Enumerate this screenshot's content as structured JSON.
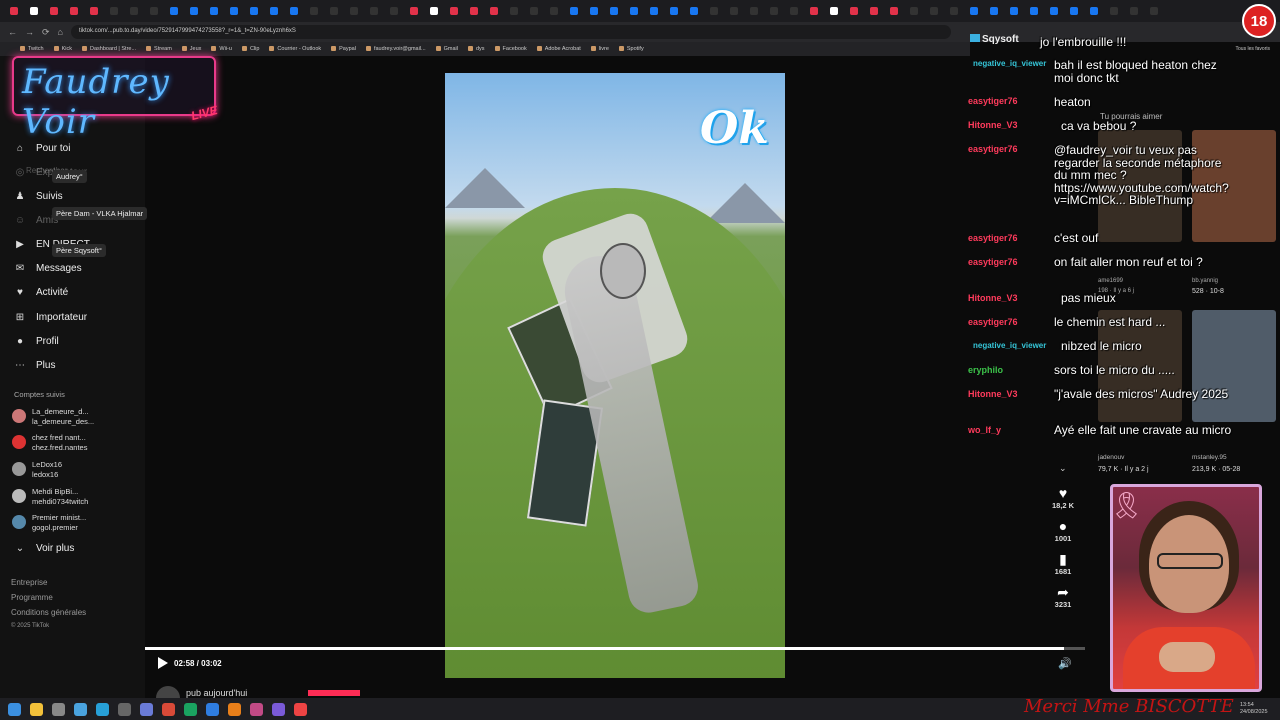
{
  "browser": {
    "url": "tiktok.com/...pub.to.day/video/7529147999474273558?_r=1&_t=ZN-90eLyznh6xS",
    "bookmarks": [
      "Twitch",
      "Kick",
      "Dashboard | Stre...",
      "Stream",
      "Jeux",
      "Wii-u",
      "Clip",
      "Courrier - Outlook",
      "Paypal",
      "faudrey.voir@gmail...",
      "Gmail",
      "dys",
      "Facebook",
      "Adobe Acrobat",
      "livre",
      "Spotify"
    ],
    "favorites_label": "Tous les favoris"
  },
  "overlay": {
    "logo_text": "Faudrey Voir",
    "logo_live": "LIVE",
    "age_badge": "18",
    "footer_text": "Merci Mme BISCOTTE"
  },
  "sidebar": {
    "search_placeholder": "Rechercher",
    "items": [
      {
        "icon": "home-icon",
        "label": "Pour toi"
      },
      {
        "icon": "compass-icon",
        "label": "Explorateur"
      },
      {
        "icon": "following-icon",
        "label": "Suivis"
      },
      {
        "icon": "friends-icon",
        "label": "Amis"
      },
      {
        "icon": "live-icon",
        "label": "EN DIRECT"
      },
      {
        "icon": "messages-icon",
        "label": "Messages"
      },
      {
        "icon": "activity-icon",
        "label": "Activité"
      },
      {
        "icon": "upload-icon",
        "label": "Importateur"
      },
      {
        "icon": "profile-icon",
        "label": "Profil"
      },
      {
        "icon": "more-icon",
        "label": "Plus"
      }
    ],
    "tooltips": [
      "Audrey°",
      "Père Dam - VLKA Hjalmar",
      "Père Sqysoft°"
    ],
    "accounts_title": "Comptes suivis",
    "accounts": [
      {
        "name": "La_demeure_d...",
        "handle": "la_demeure_des..."
      },
      {
        "name": "chez fred nant...",
        "handle": "chez.fred.nantes"
      },
      {
        "name": "LeDox16",
        "handle": "ledox16"
      },
      {
        "name": "Mehdi BipBi...",
        "handle": "mehdi0734twitch"
      },
      {
        "name": "Premier minist...",
        "handle": "gogol.premier"
      }
    ],
    "see_more": "Voir plus",
    "footer": [
      "Entreprise",
      "Programme",
      "Conditions générales",
      "© 2025 TikTok"
    ]
  },
  "video": {
    "sticker": "Ok",
    "time": "02:58 / 03:02",
    "progress": 0.978,
    "caption": "pub aujourd'hui",
    "actions": [
      {
        "icon": "heart-icon",
        "count": "18,2 K"
      },
      {
        "icon": "comment-icon",
        "count": "1001"
      },
      {
        "icon": "bookmark-icon",
        "count": "1681"
      },
      {
        "icon": "share-icon",
        "count": "3231"
      }
    ]
  },
  "chat": {
    "pinned_user": "Sqysoft",
    "pinned_message": "jo l'embrouille !!!",
    "names": [
      {
        "name": "negative_iq_viewer",
        "color": "#35c5d8"
      },
      {
        "name": "easytiger76",
        "color": "#ff3b5c"
      },
      {
        "name": "Hitonne_V3",
        "color": "#ff3b5c"
      },
      {
        "name": "easytiger76",
        "color": "#ff3b5c"
      },
      {
        "name": "easytiger76",
        "color": "#ff3b5c"
      },
      {
        "name": "easytiger76",
        "color": "#ff3b5c"
      },
      {
        "name": "Hitonne_V3",
        "color": "#ff3b5c"
      },
      {
        "name": "easytiger76",
        "color": "#ff3b5c"
      },
      {
        "name": "negative_iq_viewer",
        "color": "#35c5d8"
      },
      {
        "name": "eryphilo",
        "color": "#3cc24a"
      },
      {
        "name": "Hitonne_V3",
        "color": "#ff3b5c"
      },
      {
        "name": "wo_lf_y",
        "color": "#ff3b5c"
      }
    ],
    "lines": [
      "bah il est bloqued heaton chez moi donc tkt",
      "heaton",
      "ca va bebou ?",
      "@faudrey_voir tu veux pas regarder la seconde métaphore du mm mec ? https://www.youtube.com/watch?v=iMCmlCk... BibleThump",
      "c'est ouf",
      "on fait aller mon reuf et toi ?",
      "pas mieux",
      "le chemin est hard ...",
      "nibzed le micro",
      "sors toi le micro du .....",
      "\"j'avale des micros\" Audrey 2025",
      "Ayé elle fait une cravate au micro"
    ]
  },
  "suggestions": {
    "title": "Tu pourrais aimer",
    "items": [
      {
        "author": "ame1699",
        "stats": "198 · Il y a 6 j"
      },
      {
        "author": "bb.yannig",
        "stats": "528 · 10-8"
      },
      {
        "author": "jadenouv",
        "stats": "79,7 K · Il y a 2 j"
      },
      {
        "author": "mstanley.95",
        "stats": "213,9 K · 05-28"
      }
    ]
  },
  "clock": {
    "time": "13:54",
    "date": "24/08/2025"
  }
}
